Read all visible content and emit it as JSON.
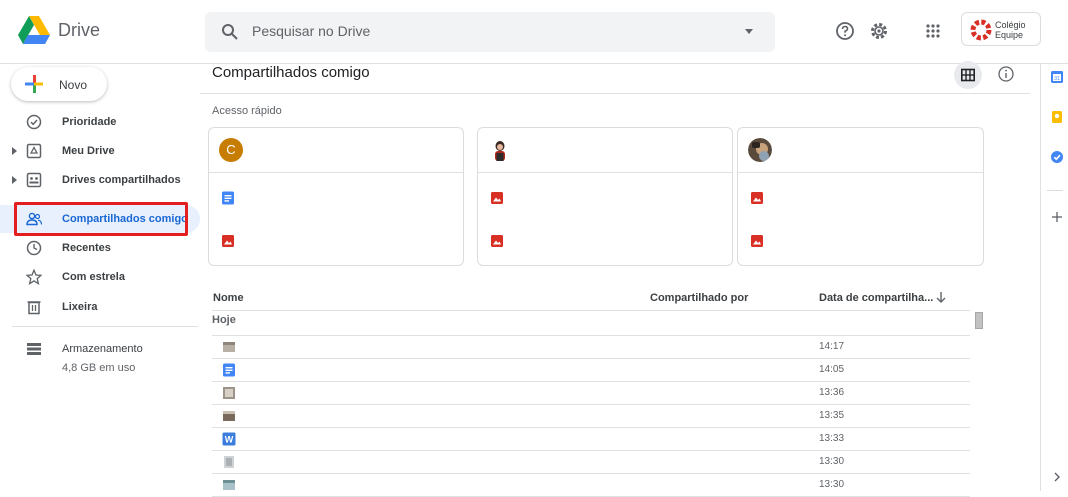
{
  "app": {
    "name": "Drive"
  },
  "search": {
    "placeholder": "Pesquisar no Drive"
  },
  "topbar": {
    "icons": [
      "help-icon",
      "settings-icon",
      "apps-grid-icon"
    ],
    "org_name_line1": "Colégio",
    "org_name_line2": "Equipe"
  },
  "sidebar": {
    "new_label": "Novo",
    "items": [
      {
        "label": "Prioridade",
        "icon": "check-circle-icon"
      },
      {
        "label": "Meu Drive",
        "icon": "my-drive-icon"
      },
      {
        "label": "Drives compartilhados",
        "icon": "shared-drives-icon"
      },
      {
        "label": "Compartilhados comigo",
        "icon": "shared-people-icon",
        "active": true
      },
      {
        "label": "Recentes",
        "icon": "clock-icon"
      },
      {
        "label": "Com estrela",
        "icon": "star-icon"
      },
      {
        "label": "Lixeira",
        "icon": "trash-icon"
      }
    ],
    "storage_label": "Armazenamento",
    "storage_used": "4,8 GB em uso"
  },
  "main": {
    "title": "Compartilhados comigo",
    "quick_access_title": "Acesso rápido",
    "cards": [
      {
        "avatar_letter": "C",
        "files": [
          "doc-icon",
          "image-icon"
        ]
      },
      {
        "avatar_letter": "",
        "files": [
          "image-icon",
          "image-icon"
        ]
      },
      {
        "avatar_letter": "",
        "files": [
          "image-icon",
          "image-icon"
        ]
      }
    ],
    "columns": {
      "name": "Nome",
      "shared_by": "Compartilhado por",
      "date": "Data de compartilha..."
    },
    "group_today": "Hoje",
    "rows": [
      {
        "icon": "image-thumb-icon",
        "time": "14:17"
      },
      {
        "icon": "doc-icon",
        "time": "14:05"
      },
      {
        "icon": "image-thumb-icon",
        "time": "13:36"
      },
      {
        "icon": "image-thumb-icon",
        "time": "13:35"
      },
      {
        "icon": "word-icon",
        "time": "13:33"
      },
      {
        "icon": "image-thumb-icon",
        "time": "13:30"
      },
      {
        "icon": "image-thumb-icon",
        "time": "13:30"
      }
    ]
  },
  "colors": {
    "accent": "#1967d2",
    "highlight": "#e41e1e",
    "active_bg": "#e8f0fe"
  }
}
